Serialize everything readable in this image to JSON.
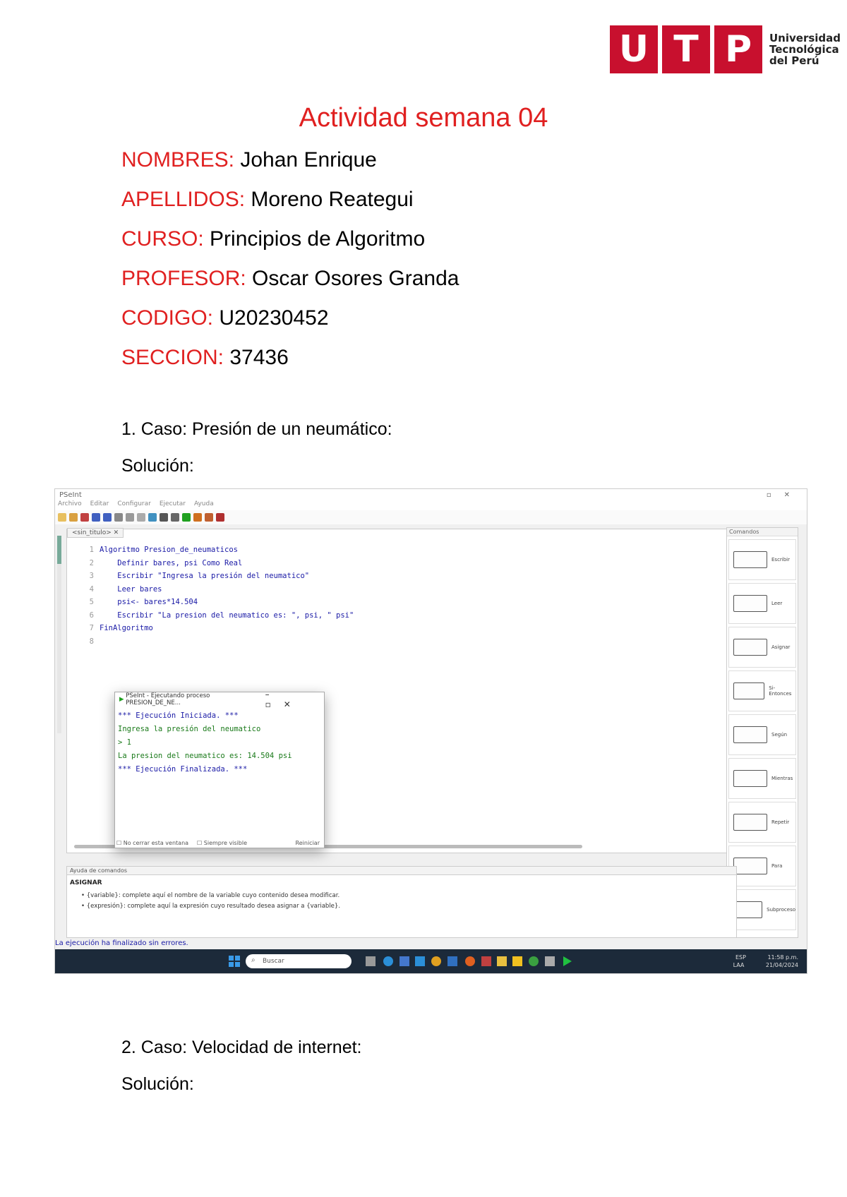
{
  "logo": {
    "letters": [
      "U",
      "T",
      "P"
    ],
    "text_lines": [
      "Universidad",
      "Tecnológica",
      "del Perú"
    ],
    "color": "#c8102e"
  },
  "title": "Actividad semana 04",
  "fields": [
    {
      "label": "NOMBRES:",
      "value": "Johan Enrique"
    },
    {
      "label": "APELLIDOS:",
      "value": "Moreno Reategui"
    },
    {
      "label": "CURSO:",
      "value": "Principios de Algoritmo"
    },
    {
      "label": "PROFESOR:",
      "value": "Oscar Osores Granda"
    },
    {
      "label": "CODIGO:",
      "value": "U20230452"
    },
    {
      "label": "SECCION:",
      "value": "37436"
    }
  ],
  "case1": {
    "heading": "1. Caso: Presión de un neumático:",
    "solution": "Solución:"
  },
  "case2": {
    "heading": "2. Caso: Velocidad de internet:",
    "solution": "Solución:"
  },
  "screenshot": {
    "app_title": "PSeInt",
    "menu": [
      "Archivo",
      "Editar",
      "Configurar",
      "Ejecutar",
      "Ayuda"
    ],
    "tab": "<sin_titulo> ✕",
    "code": [
      {
        "n": "1",
        "text": "Algoritmo Presion_de_neumaticos"
      },
      {
        "n": "2",
        "text": "    Definir bares, psi Como Real"
      },
      {
        "n": "3",
        "text": "    Escribir \"Ingresa la presión del neumatico\""
      },
      {
        "n": "4",
        "text": "    Leer bares"
      },
      {
        "n": "5",
        "text": "    psi<- bares*14.504"
      },
      {
        "n": "6",
        "text": "    Escribir \"La presion del neumatico es: \", psi, \" psi\""
      },
      {
        "n": "7",
        "text": "FinAlgoritmo"
      },
      {
        "n": "8",
        "text": ""
      }
    ],
    "run_window": {
      "title": "PSeInt - Ejecutando proceso PRESION_DE_NE...",
      "output": [
        "*** Ejecución Iniciada. ***",
        "Ingresa la presión del neumatico",
        "> 1",
        "La presion del neumatico es: 14.504 psi",
        "*** Ejecución Finalizada. ***"
      ],
      "footer_left": "No cerrar esta ventana",
      "footer_mid": "Siempre visible",
      "footer_right": "Reiniciar"
    },
    "sidebar_title": "Comandos",
    "commands": [
      "Escribir",
      "Leer",
      "Asignar",
      "Si-Entonces",
      "Según",
      "Mientras",
      "Repetir",
      "Para",
      "Subproceso"
    ],
    "help_bar": "Ayuda de comandos",
    "help_title": "ASIGNAR",
    "help_lines": [
      "• {variable}: complete aquí el nombre de la variable cuyo contenido desea modificar.",
      "• {expresión}: complete aquí la expresión cuyo resultado desea asignar a {variable}."
    ],
    "status": "La ejecución ha finalizado sin errores.",
    "search_placeholder": "Buscar",
    "tray_lang": [
      "ESP",
      "LAA"
    ],
    "tray_time": [
      "11:58 p.m.",
      "21/04/2024"
    ]
  }
}
